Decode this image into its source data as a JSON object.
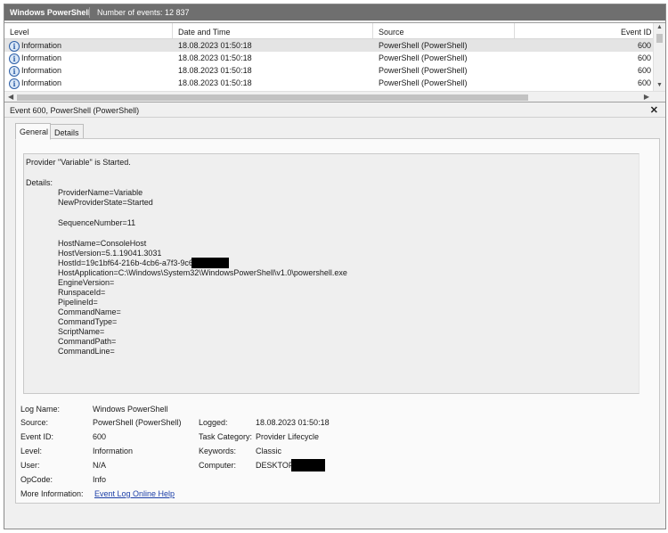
{
  "header": {
    "title": "Windows PowerShell",
    "event_count": "Number of events: 12 837"
  },
  "list": {
    "columns": [
      "Level",
      "Date and Time",
      "Source",
      "Event ID"
    ],
    "rows": [
      {
        "level": "Information",
        "datetime": "18.08.2023 01:50:18",
        "source": "PowerShell (PowerShell)",
        "event_id": "600"
      },
      {
        "level": "Information",
        "datetime": "18.08.2023 01:50:18",
        "source": "PowerShell (PowerShell)",
        "event_id": "600"
      },
      {
        "level": "Information",
        "datetime": "18.08.2023 01:50:18",
        "source": "PowerShell (PowerShell)",
        "event_id": "600"
      },
      {
        "level": "Information",
        "datetime": "18.08.2023 01:50:18",
        "source": "PowerShell (PowerShell)",
        "event_id": "600"
      }
    ]
  },
  "detail": {
    "title": "Event 600, PowerShell (PowerShell)",
    "close": "✕",
    "tabs": [
      "General",
      "Details"
    ],
    "message": {
      "line1": "Provider \"Variable\" is Started.",
      "details_label": "Details:",
      "provider_name": "ProviderName=Variable",
      "new_state": "NewProviderState=Started",
      "sequence": "SequenceNumber=11",
      "host_name": "HostName=ConsoleHost",
      "host_version": "HostVersion=5.1.19041.3031",
      "host_id": "HostId=19c1bf64-216b-4cb6-a7f3-9c6",
      "host_application": "HostApplication=C:\\Windows\\System32\\WindowsPowerShell\\v1.0\\powershell.exe",
      "engine_version": "EngineVersion=",
      "runspace_id": "RunspaceId=",
      "pipeline_id": "PipelineId=",
      "command_name": "CommandName=",
      "command_type": "CommandType=",
      "script_name": "ScriptName=",
      "command_path": "CommandPath=",
      "command_line": "CommandLine="
    },
    "fields": {
      "log_name_label": "Log Name:",
      "log_name": "Windows PowerShell",
      "source_label": "Source:",
      "source": "PowerShell (PowerShell)",
      "logged_label": "Logged:",
      "logged": "18.08.2023 01:50:18",
      "event_id_label": "Event ID:",
      "event_id": "600",
      "task_label": "Task Category:",
      "task": "Provider Lifecycle",
      "level_label": "Level:",
      "level": "Information",
      "keywords_label": "Keywords:",
      "keywords": "Classic",
      "user_label": "User:",
      "user": "N/A",
      "computer_label": "Computer:",
      "computer": "DESKTOP-",
      "opcode_label": "OpCode:",
      "opcode": "Info",
      "more_info_label": "More Information:",
      "more_info_link": "Event Log Online Help"
    }
  }
}
